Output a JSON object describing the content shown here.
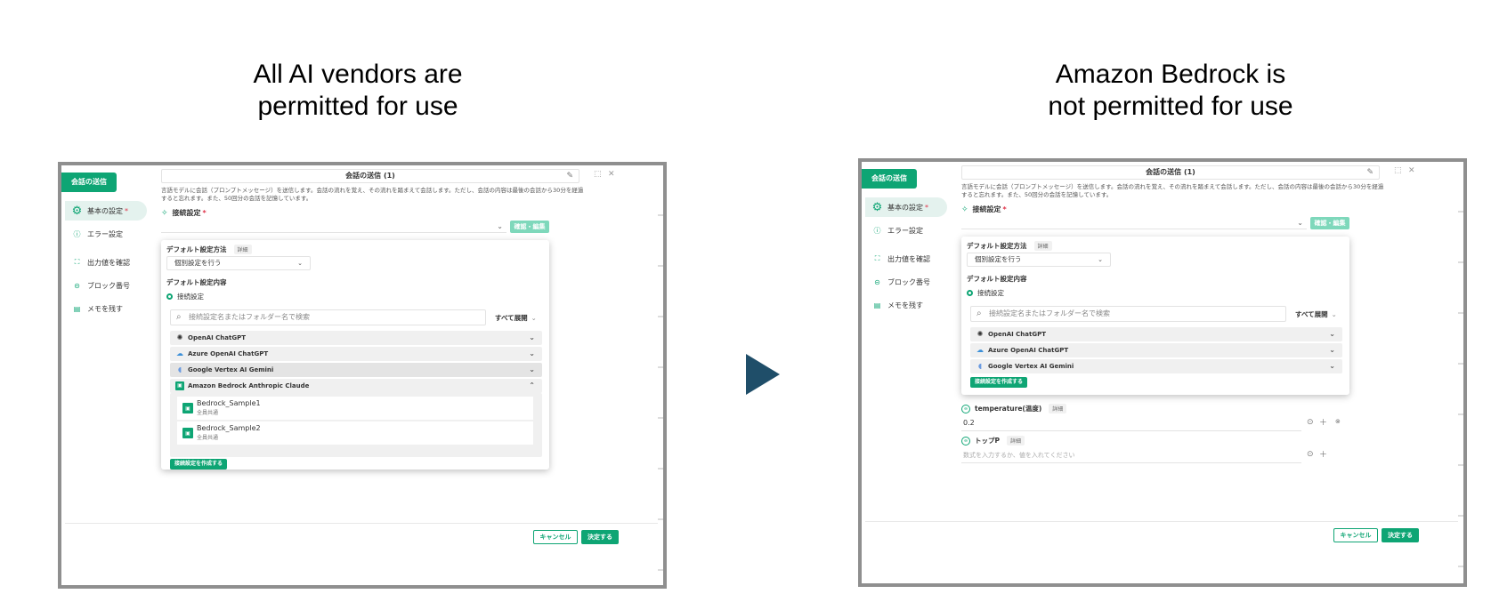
{
  "captions": {
    "left_line1": "All AI vendors are",
    "left_line2": "permitted for use",
    "right_line1": "Amazon Bedrock is",
    "right_line2": "not permitted for use"
  },
  "app": {
    "send_tab": "会話の送信",
    "title": "会話の送信 (1)",
    "description": "言語モデルに会話（プロンプトメッセージ）を送信します。会話の流れを覚え、その流れを踏まえて会話します。ただし、会話の内容は最後の会話から30分を経過すると忘れます。また、50回分の会話を記憶しています。",
    "sidebar": {
      "basic": "基本の設定",
      "required_mark": "*",
      "error": "エラー設定",
      "output": "出力値を確認",
      "block_no": "ブロック番号",
      "memo": "メモを残す"
    },
    "connection_label": "接続設定",
    "confirm_edit": "確認・編集",
    "panel": {
      "default_method_label": "デフォルト設定方法",
      "detail": "詳細",
      "method_value": "個別設定を行う",
      "default_content_label": "デフォルト設定内容",
      "radio_connection": "接続設定",
      "search_placeholder": "接続設定名またはフォルダー名で検索",
      "expand_all": "すべて展開",
      "create_connection": "接続設定を作成する"
    },
    "vendors": {
      "openai": "OpenAI ChatGPT",
      "azure": "Azure OpenAI ChatGPT",
      "gcp": "Google Vertex AI Gemini",
      "aws": "Amazon Bedrock Anthropic Claude"
    },
    "bedrock_items": [
      {
        "name": "Bedrock_Sample1",
        "sub": "全員共通"
      },
      {
        "name": "Bedrock_Sample2",
        "sub": "全員共通"
      }
    ],
    "params": {
      "temperature_label": "temperature(温度)",
      "temperature_value": "0.2",
      "top_p_label": "トップP",
      "top_p_placeholder": "数式を入力するか、値を入れてください"
    },
    "footer": {
      "cancel": "キャンセル",
      "ok": "決定する"
    }
  }
}
